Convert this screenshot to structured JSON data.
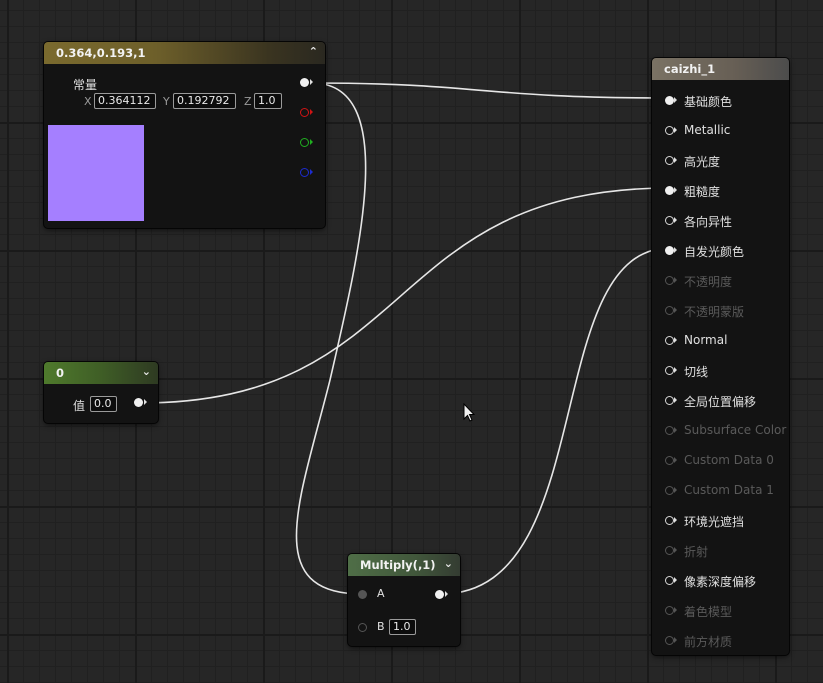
{
  "const3": {
    "title": "0.364,0.193,1",
    "label": "常量",
    "x_label": "X",
    "x_value": "0.364112",
    "y_label": "Y",
    "y_value": "0.192792",
    "z_label": "Z",
    "z_value": "1.0",
    "swatch_color": "#a57fff"
  },
  "const1": {
    "title": "0",
    "value_label": "值",
    "value": "0.0"
  },
  "multiply": {
    "title": "Multiply(,1)",
    "input_a": "A",
    "input_b": "B",
    "b_value": "1.0"
  },
  "material": {
    "title": "caizhi_1",
    "pins": [
      {
        "label": "基础颜色",
        "state": "connected"
      },
      {
        "label": "Metallic",
        "state": "active"
      },
      {
        "label": "高光度",
        "state": "active"
      },
      {
        "label": "粗糙度",
        "state": "connected"
      },
      {
        "label": "各向异性",
        "state": "active"
      },
      {
        "label": "自发光颜色",
        "state": "connected"
      },
      {
        "label": "不透明度",
        "state": "disabled"
      },
      {
        "label": "不透明蒙版",
        "state": "disabled"
      },
      {
        "label": "Normal",
        "state": "active"
      },
      {
        "label": "切线",
        "state": "active"
      },
      {
        "label": "全局位置偏移",
        "state": "active"
      },
      {
        "label": "Subsurface Color",
        "state": "disabled"
      },
      {
        "label": "Custom Data 0",
        "state": "disabled"
      },
      {
        "label": "Custom Data 1",
        "state": "disabled"
      },
      {
        "label": "环境光遮挡",
        "state": "active"
      },
      {
        "label": "折射",
        "state": "disabled"
      },
      {
        "label": "像素深度偏移",
        "state": "active"
      },
      {
        "label": "着色模型",
        "state": "disabled"
      },
      {
        "label": "前方材质",
        "state": "disabled"
      }
    ]
  },
  "colors": {
    "background": "#262626",
    "wire": "#e8e8e8",
    "gold_header": "#7a6a2e",
    "green_header": "#4f7a2c"
  }
}
